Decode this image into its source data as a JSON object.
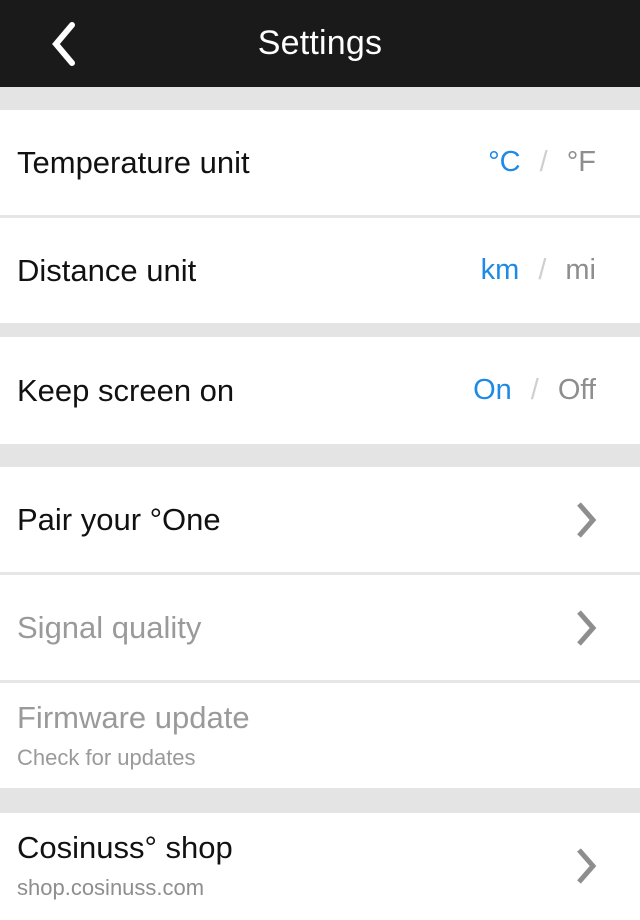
{
  "header": {
    "title": "Settings",
    "back_icon": "chevron-left-icon",
    "background": "#1a1a1a",
    "text_color": "#ffffff"
  },
  "colors": {
    "accent_blue": "#1e8ae8",
    "muted_gray": "#9a9a9a",
    "value_gray": "#8e8e8e",
    "separator_gray": "#e4e4e4",
    "divider_gray": "#e6e6e6",
    "text_black": "#111111"
  },
  "groups": [
    {
      "rows": [
        {
          "label": "Temperature unit",
          "type": "segmented",
          "options": [
            {
              "label": "°C",
              "selected": true
            },
            {
              "label": "°F",
              "selected": false
            }
          ],
          "separator": "/"
        },
        {
          "label": "Distance unit",
          "type": "segmented",
          "options": [
            {
              "label": "km",
              "selected": true
            },
            {
              "label": "mi",
              "selected": false
            }
          ],
          "separator": "/"
        }
      ]
    },
    {
      "rows": [
        {
          "label": "Keep screen on",
          "type": "segmented",
          "options": [
            {
              "label": "On",
              "selected": true
            },
            {
              "label": "Off",
              "selected": false
            }
          ],
          "separator": "/"
        }
      ]
    },
    {
      "rows": [
        {
          "label": "Pair your °One",
          "type": "navigation",
          "disabled": false,
          "chevron": "chevron-right-icon"
        },
        {
          "label": "Signal quality",
          "type": "navigation",
          "disabled": true,
          "chevron": "chevron-right-icon"
        },
        {
          "label": "Firmware update",
          "sublabel": "Check for updates",
          "type": "navigation",
          "disabled": true,
          "chevron": null
        }
      ]
    },
    {
      "rows": [
        {
          "label": "Cosinuss° shop",
          "sublabel": "shop.cosinuss.com",
          "type": "navigation",
          "disabled": false,
          "chevron": "chevron-right-icon"
        }
      ]
    }
  ]
}
